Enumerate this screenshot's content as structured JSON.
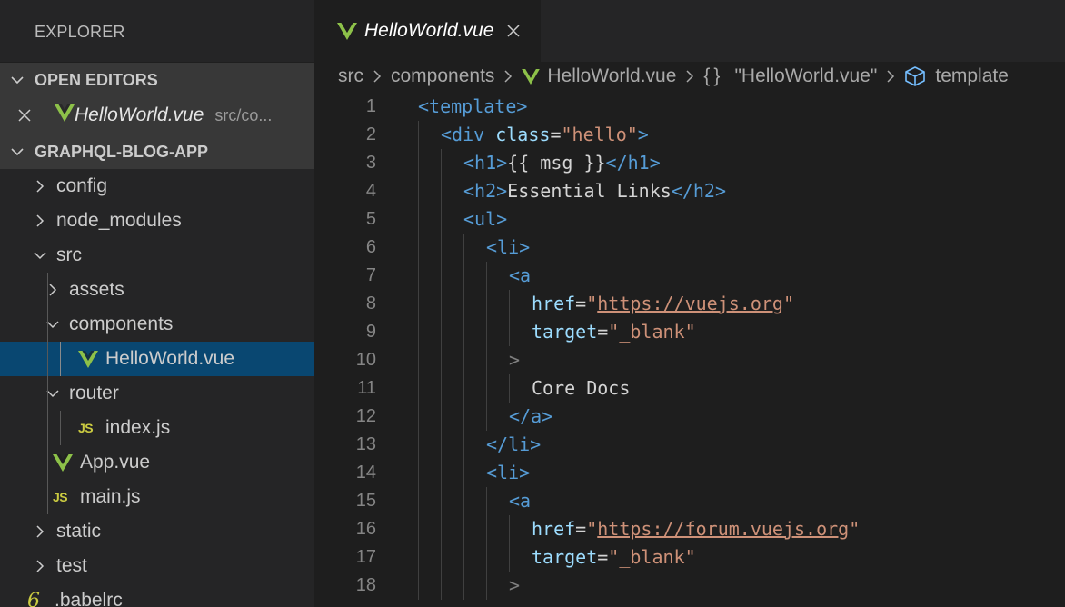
{
  "sidebar": {
    "title": "EXPLORER",
    "open_editors_label": "OPEN EDITORS",
    "open_editor": {
      "name": "HelloWorld.vue",
      "path": "src/co..."
    },
    "project_label": "GRAPHQL-BLOG-APP",
    "tree": [
      {
        "label": "config",
        "depth": 0,
        "kind": "folder",
        "expanded": false
      },
      {
        "label": "node_modules",
        "depth": 0,
        "kind": "folder",
        "expanded": false
      },
      {
        "label": "src",
        "depth": 0,
        "kind": "folder",
        "expanded": true
      },
      {
        "label": "assets",
        "depth": 1,
        "kind": "folder",
        "expanded": false
      },
      {
        "label": "components",
        "depth": 1,
        "kind": "folder",
        "expanded": true
      },
      {
        "label": "HelloWorld.vue",
        "depth": 2,
        "kind": "vue",
        "selected": true
      },
      {
        "label": "router",
        "depth": 1,
        "kind": "folder",
        "expanded": true
      },
      {
        "label": "index.js",
        "depth": 2,
        "kind": "js",
        "icon_text": "JS"
      },
      {
        "label": "App.vue",
        "depth": 1,
        "kind": "vue"
      },
      {
        "label": "main.js",
        "depth": 1,
        "kind": "js",
        "icon_text": "JS"
      },
      {
        "label": "static",
        "depth": 0,
        "kind": "folder",
        "expanded": false
      },
      {
        "label": "test",
        "depth": 0,
        "kind": "folder",
        "expanded": false
      },
      {
        "label": ".babelrc",
        "depth": 0,
        "kind": "rc",
        "icon_text": "6"
      }
    ]
  },
  "tab": {
    "title": "HelloWorld.vue"
  },
  "breadcrumbs": {
    "items": [
      "src",
      "components",
      "HelloWorld.vue",
      "\"HelloWorld.vue\"",
      "template"
    ],
    "braces": "{}"
  },
  "code": [
    {
      "n": "1",
      "indent": 0,
      "tokens": [
        [
          "tag",
          "<template"
        ],
        [
          "tag",
          ">"
        ]
      ]
    },
    {
      "n": "2",
      "indent": 1,
      "tokens": [
        [
          "tag",
          "<div"
        ],
        [
          "txt",
          " "
        ],
        [
          "attr",
          "class"
        ],
        [
          "txt",
          "="
        ],
        [
          "str",
          "\"hello\""
        ],
        [
          "tag",
          ">"
        ]
      ]
    },
    {
      "n": "3",
      "indent": 2,
      "tokens": [
        [
          "tag",
          "<h1"
        ],
        [
          "tag",
          ">"
        ],
        [
          "txt",
          "{{ msg }}"
        ],
        [
          "tag",
          "</h1"
        ],
        [
          "tag",
          ">"
        ]
      ]
    },
    {
      "n": "4",
      "indent": 2,
      "tokens": [
        [
          "tag",
          "<h2"
        ],
        [
          "tag",
          ">"
        ],
        [
          "txt",
          "Essential Links"
        ],
        [
          "tag",
          "</h2"
        ],
        [
          "tag",
          ">"
        ]
      ]
    },
    {
      "n": "5",
      "indent": 2,
      "tokens": [
        [
          "tag",
          "<ul"
        ],
        [
          "tag",
          ">"
        ]
      ]
    },
    {
      "n": "6",
      "indent": 3,
      "tokens": [
        [
          "tag",
          "<li"
        ],
        [
          "tag",
          ">"
        ]
      ]
    },
    {
      "n": "7",
      "indent": 4,
      "tokens": [
        [
          "tag",
          "<a"
        ]
      ]
    },
    {
      "n": "8",
      "indent": 5,
      "tokens": [
        [
          "attr",
          "href"
        ],
        [
          "txt",
          "="
        ],
        [
          "str",
          "\""
        ],
        [
          "strlink",
          "https://vuejs.org"
        ],
        [
          "str",
          "\""
        ]
      ]
    },
    {
      "n": "9",
      "indent": 5,
      "tokens": [
        [
          "attr",
          "target"
        ],
        [
          "txt",
          "="
        ],
        [
          "str",
          "\"_blank\""
        ]
      ]
    },
    {
      "n": "10",
      "indent": 4,
      "tokens": [
        [
          "punct",
          ">"
        ]
      ]
    },
    {
      "n": "11",
      "indent": 5,
      "tokens": [
        [
          "txt",
          "Core Docs"
        ]
      ]
    },
    {
      "n": "12",
      "indent": 4,
      "tokens": [
        [
          "tag",
          "</a"
        ],
        [
          "tag",
          ">"
        ]
      ]
    },
    {
      "n": "13",
      "indent": 3,
      "tokens": [
        [
          "tag",
          "</li"
        ],
        [
          "tag",
          ">"
        ]
      ]
    },
    {
      "n": "14",
      "indent": 3,
      "tokens": [
        [
          "tag",
          "<li"
        ],
        [
          "tag",
          ">"
        ]
      ]
    },
    {
      "n": "15",
      "indent": 4,
      "tokens": [
        [
          "tag",
          "<a"
        ]
      ]
    },
    {
      "n": "16",
      "indent": 5,
      "tokens": [
        [
          "attr",
          "href"
        ],
        [
          "txt",
          "="
        ],
        [
          "str",
          "\""
        ],
        [
          "strlink",
          "https://forum.vuejs.org"
        ],
        [
          "str",
          "\""
        ]
      ]
    },
    {
      "n": "17",
      "indent": 5,
      "tokens": [
        [
          "attr",
          "target"
        ],
        [
          "txt",
          "="
        ],
        [
          "str",
          "\"_blank\""
        ]
      ]
    },
    {
      "n": "18",
      "indent": 4,
      "tokens": [
        [
          "punct",
          ">"
        ]
      ]
    }
  ],
  "colors": {
    "vue_dark": "#41b883",
    "vue_light": "#8dc149",
    "selection": "#094771",
    "tag": "#569cd6",
    "attribute": "#9cdcfe",
    "string": "#ce9178"
  }
}
